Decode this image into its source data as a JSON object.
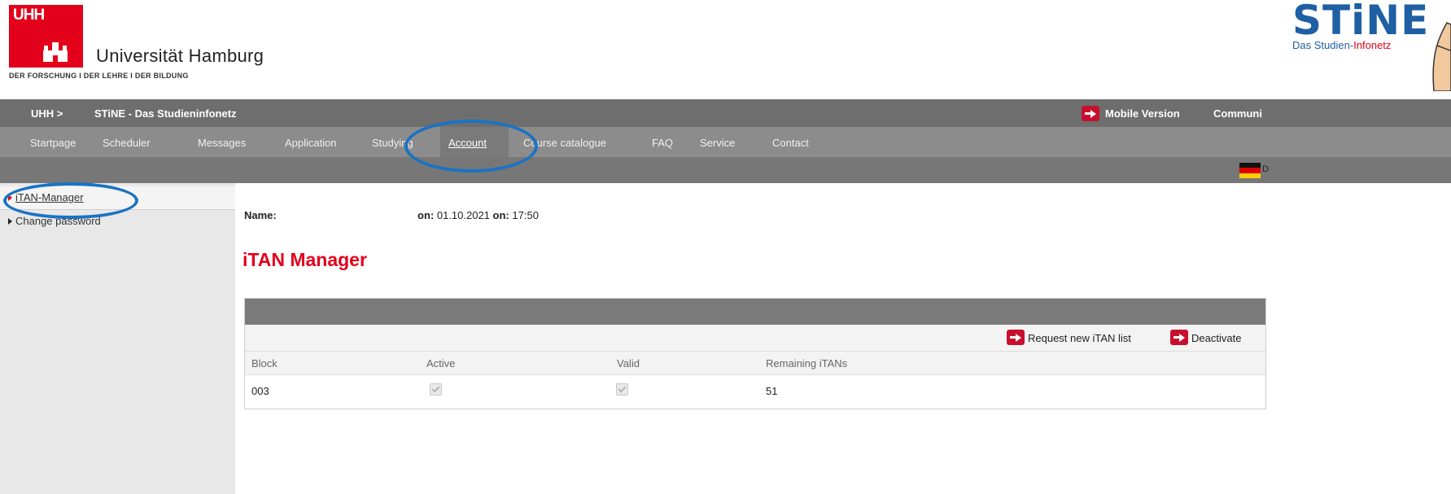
{
  "header": {
    "uhh_mark": "UHH",
    "university_name": "Universität Hamburg",
    "claim": "DER FORSCHUNG I DER LEHRE I DER BILDUNG",
    "stine_word": "STiNE",
    "stine_sub_a": "Das Studien-",
    "stine_sub_b": "Infonetz"
  },
  "topbar": {
    "crumb_home": "UHH >",
    "crumb_portal": "STiNE - Das Studieninfonetz",
    "mobile_version": "Mobile Version",
    "community": "Communi"
  },
  "nav": {
    "items": [
      "Startpage",
      "Scheduler",
      "Messages",
      "Application",
      "Studying",
      "Account",
      "Course catalogue",
      "FAQ",
      "Service",
      "Contact"
    ],
    "active": "Account"
  },
  "language": {
    "label": "D"
  },
  "sidebar": {
    "items": [
      {
        "label": "iTAN-Manager",
        "active": true
      },
      {
        "label": "Change password",
        "active": false
      }
    ]
  },
  "main": {
    "name_label": "Name:",
    "date_prefix": "on:",
    "date": "01.10.2021",
    "time_prefix": "on:",
    "time": "17:50",
    "title": "iTAN Manager",
    "actions": {
      "request": "Request new iTAN list",
      "deactivate": "Deactivate"
    },
    "table": {
      "headers": [
        "Block",
        "Active",
        "Valid",
        "Remaining iTANs"
      ],
      "rows": [
        {
          "block": "003",
          "active": true,
          "valid": true,
          "remaining": "51"
        }
      ]
    }
  },
  "colors": {
    "uhh_red": "#e2001a",
    "stine_blue": "#1f5fa3",
    "annotation_blue": "#1a73c4",
    "bar_grey": "#6e6e6e"
  }
}
